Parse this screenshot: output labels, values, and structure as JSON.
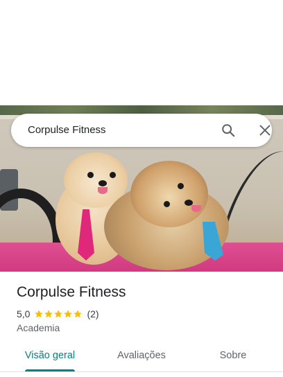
{
  "search": {
    "query": "Corpulse Fitness",
    "search_icon": "search-icon",
    "close_icon": "close-icon"
  },
  "place": {
    "name": "Corpulse Fitness",
    "rating": "5,0",
    "stars": 5,
    "reviews": "(2)",
    "category": "Academia"
  },
  "tabs": [
    {
      "label": "Visão geral",
      "active": true
    },
    {
      "label": "Avaliações",
      "active": false
    },
    {
      "label": "Sobre",
      "active": false
    }
  ],
  "colors": {
    "accent": "#0b7f7c",
    "star": "#fbbc04",
    "text": "#202124",
    "secondary": "#5f6368"
  }
}
